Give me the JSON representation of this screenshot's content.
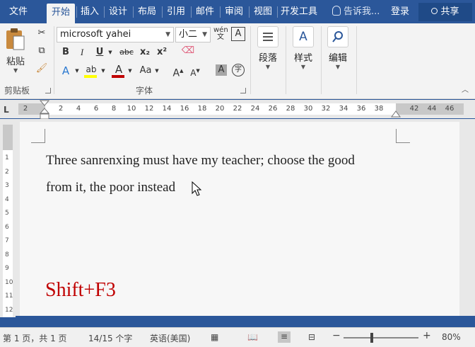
{
  "tabs": {
    "file": "文件",
    "home": "开始",
    "insert": "插入",
    "design": "设计",
    "layout": "布局",
    "references": "引用",
    "mailings": "邮件",
    "review": "审阅",
    "view": "视图",
    "developer": "开发工具"
  },
  "tell_me": "告诉我...",
  "login": "登录",
  "share": "共享",
  "ribbon": {
    "paste_label": "粘贴",
    "clipboard_group": "剪贴板",
    "font_name": "microsoft yahei",
    "font_size": "小二",
    "font_group": "字体",
    "bold": "B",
    "italic": "I",
    "underline": "U",
    "strike": "abc",
    "subscript": "x₂",
    "superscript": "x²",
    "font_color_letter": "A",
    "change_case": "Aa",
    "grow_font": "A",
    "shrink_font": "A",
    "char_shading": "A",
    "enclose": "字",
    "phonetic": "文",
    "char_border": "A",
    "paragraph_label": "段落",
    "styles_label": "样式",
    "editing_label": "编辑"
  },
  "ruler": {
    "tab_selector": "L",
    "ticks": [
      "2",
      "2",
      "4",
      "6",
      "8",
      "10",
      "12",
      "14",
      "16",
      "18",
      "20",
      "22",
      "24",
      "26",
      "28",
      "30",
      "32",
      "34",
      "36",
      "38",
      "42",
      "44",
      "46"
    ]
  },
  "vruler_ticks": [
    "1",
    "2",
    "3",
    "4",
    "5",
    "6",
    "7",
    "8",
    "9",
    "10",
    "11",
    "12"
  ],
  "document": {
    "line1": "Three sanrenxing must have my teacher; choose the good",
    "line2": "from it, the poor instead",
    "shortcut": "Shift+F3"
  },
  "status": {
    "pages": "第 1 页，共 1 页",
    "words": "14/15 个字",
    "language": "英语(美国)",
    "zoom": "80%",
    "zoom_out": "−",
    "zoom_in": "+"
  },
  "colors": {
    "accent": "#2b579a",
    "shortcut_red": "#c00000",
    "font_color": "#c00000",
    "highlight": "#ffff00"
  }
}
